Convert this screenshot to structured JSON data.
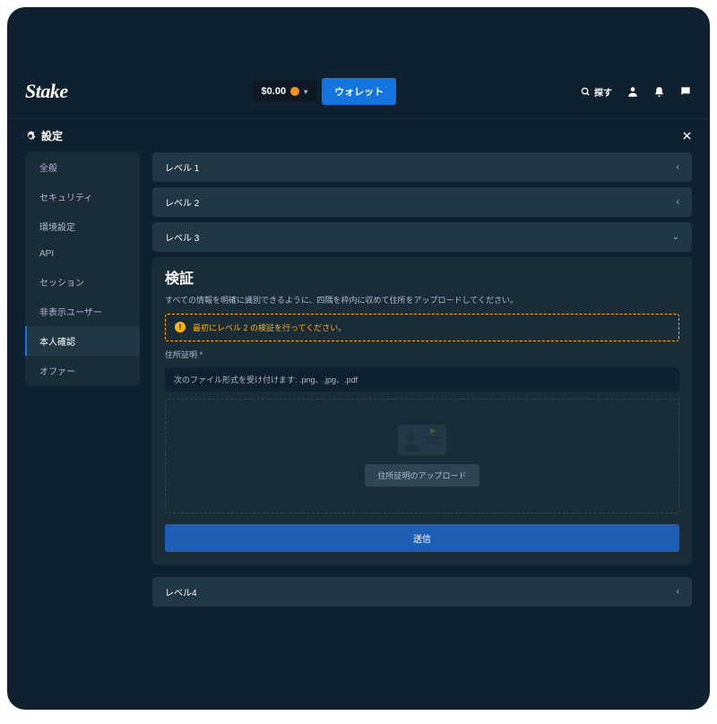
{
  "brand": "Stake",
  "balance": {
    "amount": "$0.00"
  },
  "wallet_button": "ウォレット",
  "search_label": "探す",
  "settings_title": "設定",
  "sidebar": {
    "items": [
      {
        "label": "全般"
      },
      {
        "label": "セキュリティ"
      },
      {
        "label": "環境設定"
      },
      {
        "label": "API"
      },
      {
        "label": "セッション"
      },
      {
        "label": "非表示ユーザー"
      },
      {
        "label": "本人確認"
      },
      {
        "label": "オファー"
      }
    ],
    "active_index": 6
  },
  "levels": {
    "l1": "レベル 1",
    "l2": "レベル 2",
    "l3": "レベル 3",
    "l4": "レベル4"
  },
  "verify": {
    "title": "検証",
    "description": "すべての情報を明確に識別できるように、四隅を枠内に収めて住所をアップロードしてください。",
    "warning": "最初にレベル 2 の検証を行ってください。",
    "field_label": "住所証明",
    "file_hint": "次のファイル形式を受け付けます: .png、.jpg、.pdf",
    "upload_button": "住所証明のアップロード",
    "submit": "送信"
  }
}
